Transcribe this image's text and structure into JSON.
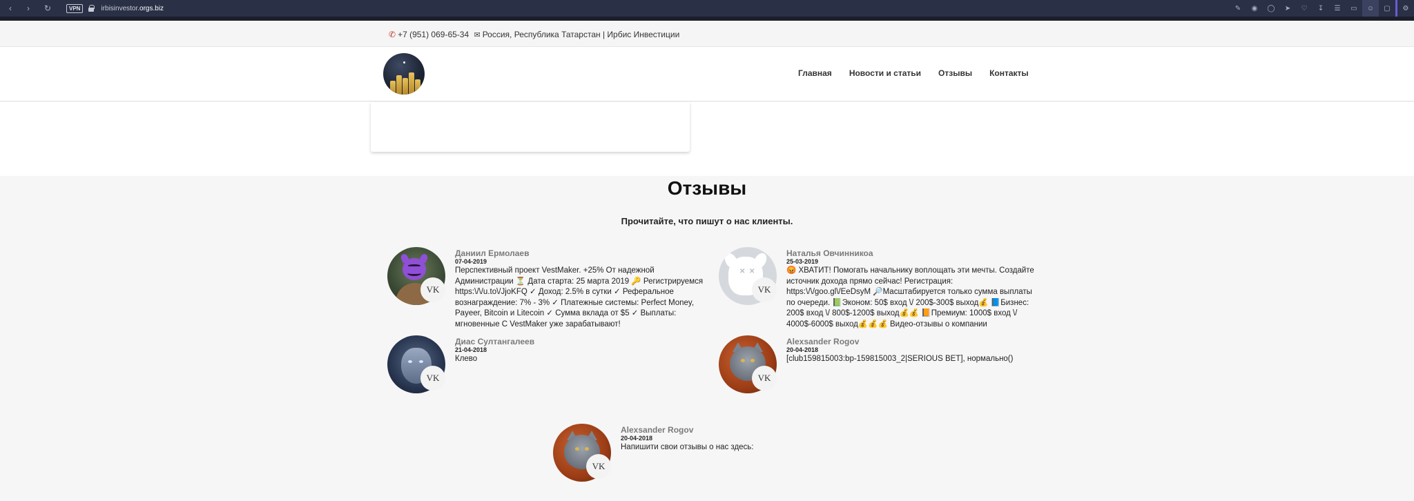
{
  "browser": {
    "vpn_label": "VPN",
    "url_prefix": "irbisinvestor.",
    "url_domain": "orgs.biz"
  },
  "topbar": {
    "phone": "+7 (951) 069-65-34",
    "location": "Россия, Республика Татарстан | Ирбис Инвестиции"
  },
  "nav": {
    "items": [
      {
        "label": "Главная"
      },
      {
        "label": "Новости и статьи"
      },
      {
        "label": "Отзывы"
      },
      {
        "label": "Контакты"
      }
    ]
  },
  "reviews": {
    "title": "Отзывы",
    "subtitle": "Прочитайте, что пишут о нас клиенты.",
    "badge_label": "VK",
    "items": [
      {
        "name": "Даниил Ермолаев",
        "date": "07-04-2019",
        "text": "Перспективный проект VestMaker. +25% От надежной Администрации ⏳ Дата старта: 25 марта 2019 🔑 Регистрируемся https:\\/\\/u.to\\/JjoKFQ ✓ Доход: 2.5% в сутки ✓ Реферальное вознаграждение: 7% - 3% ✓ Платежные системы: Perfect Money, Payeer, Bitcoin и Litecoin ✓ Сумма вклада от $5 ✓ Выплаты: мгновенные С VestMaker уже зарабатывают!"
      },
      {
        "name": "Наталья Овчинникоа",
        "date": "25-03-2019",
        "text": "😡 ХВАТИТ! Помогать начальнику воплощать эти мечты. Создайте источник дохода прямо сейчас! Регистрация: https:\\/\\/goo.gl\\/EeDsyM 🔎Масштабируется только сумма выплаты по очереди. 📗Эконом: 50$ вход \\/ 200$-300$ выход💰 📘Бизнес: 200$ вход \\/ 800$-1200$ выход💰💰 📙Премиум: 1000$ вход \\/ 4000$-6000$ выход💰💰💰 Видео-отзывы о компании"
      },
      {
        "name": "Диас Султангалеев",
        "date": "21-04-2018",
        "text": "Клево"
      },
      {
        "name": "Alexsander Rogov",
        "date": "20-04-2018",
        "text": "[club159815003:bp-159815003_2|SERIOUS BET], нормально()"
      },
      {
        "name": "Alexsander Rogov",
        "date": "20-04-2018",
        "text": "Напишити свои отзывы о нас здесь:"
      }
    ]
  }
}
